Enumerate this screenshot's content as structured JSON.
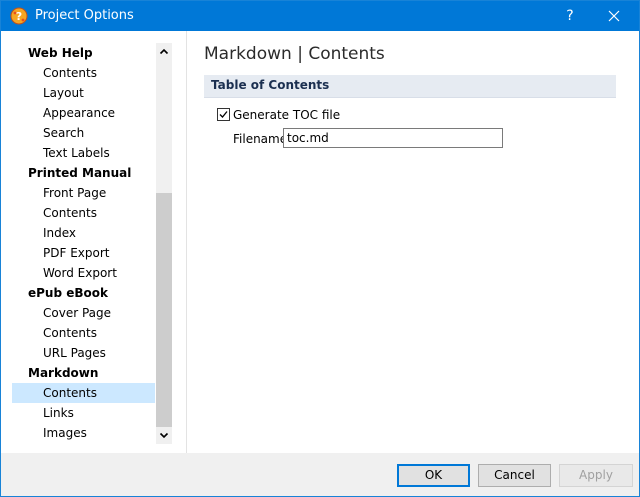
{
  "window": {
    "title": "Project Options",
    "help_glyph": "?",
    "icon": "app-help-icon"
  },
  "nav": {
    "items": [
      {
        "label": "Web Help",
        "kind": "group"
      },
      {
        "label": "Contents",
        "kind": "child"
      },
      {
        "label": "Layout",
        "kind": "child"
      },
      {
        "label": "Appearance",
        "kind": "child"
      },
      {
        "label": "Search",
        "kind": "child"
      },
      {
        "label": "Text Labels",
        "kind": "child"
      },
      {
        "label": "Printed Manual",
        "kind": "group"
      },
      {
        "label": "Front Page",
        "kind": "child"
      },
      {
        "label": "Contents",
        "kind": "child"
      },
      {
        "label": "Index",
        "kind": "child"
      },
      {
        "label": "PDF Export",
        "kind": "child"
      },
      {
        "label": "Word Export",
        "kind": "child"
      },
      {
        "label": "ePub eBook",
        "kind": "group"
      },
      {
        "label": "Cover Page",
        "kind": "child"
      },
      {
        "label": "Contents",
        "kind": "child"
      },
      {
        "label": "URL Pages",
        "kind": "child"
      },
      {
        "label": "Markdown",
        "kind": "group"
      },
      {
        "label": "Contents",
        "kind": "child",
        "selected": true
      },
      {
        "label": "Links",
        "kind": "child"
      },
      {
        "label": "Images",
        "kind": "child"
      }
    ]
  },
  "main": {
    "page_title": "Markdown | Contents",
    "section_title": "Table of Contents",
    "generate_toc": {
      "label": "Generate TOC file",
      "checked": true
    },
    "filename": {
      "label": "Filename:",
      "value": "toc.md"
    }
  },
  "footer": {
    "ok": "OK",
    "cancel": "Cancel",
    "apply": "Apply"
  },
  "colors": {
    "titlebar": "#0078d7",
    "selected_item": "#cce8ff",
    "section_band": "#e6ebf2",
    "default_button_border": "#0078d7"
  }
}
